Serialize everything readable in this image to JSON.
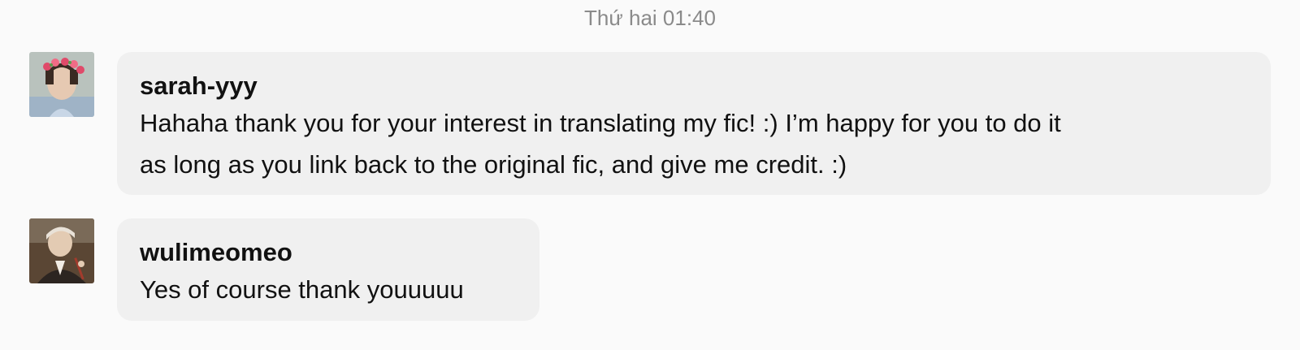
{
  "conversation": {
    "date_separator": "Thứ hai 01:40",
    "messages": [
      {
        "sender": "sarah-yyy",
        "text": "Hahaha thank you for your interest in translating my fic! :) I’m happy for you to do it\nas long as you link back to the original fic, and give me credit. :)",
        "avatar_icon": "user-avatar-flower-crown"
      },
      {
        "sender": "wulimeomeo",
        "text": "Yes of course thank youuuuu",
        "avatar_icon": "user-avatar-photo"
      }
    ]
  },
  "colors": {
    "background": "#fafafa",
    "bubble": "#f0f0f0",
    "timestamp": "#8a8a8a"
  }
}
